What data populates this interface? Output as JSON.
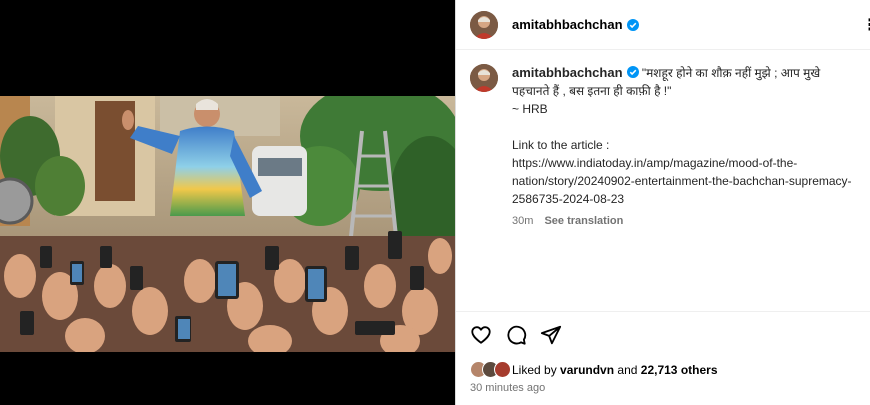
{
  "post": {
    "username": "amitabhbachchan",
    "caption_lines": [
      "\"मशहूर होने का शौक़ नहीं मुझे ; आप मुखे",
      "पहचानते हैं , बस इतना ही काफ़ी है !\"",
      "~ HRB",
      "",
      "Link to the article :",
      "https://www.indiatoday.in/amp/magazine/mood-of-the-",
      "nation/story/20240902-entertainment-the-bachchan-supremacy-",
      "2586735-2024-08-23"
    ],
    "caption_age": "30m",
    "see_translation": "See translation",
    "liked_by_prefix": "Liked by",
    "liked_by_user": "varundvn",
    "liked_by_and": "and",
    "liked_by_others": "22,713 others",
    "timestamp": "30 minutes ago"
  },
  "colors": {
    "verified": "#0095f6",
    "secondary_text": "#737373",
    "border": "#dbdbdb"
  },
  "icons": [
    "verified-icon",
    "more-options-icon",
    "heart-icon",
    "comment-icon",
    "share-icon"
  ]
}
